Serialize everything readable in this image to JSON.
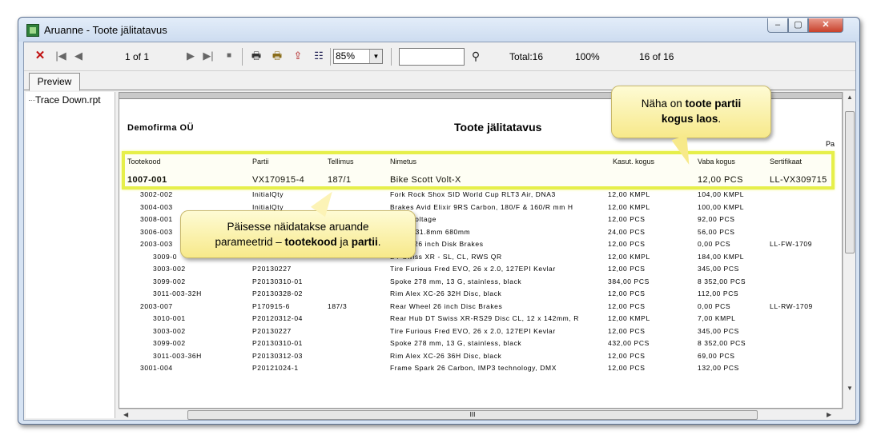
{
  "window": {
    "title": "Aruanne - Toote jälitatavus",
    "minimize": "–",
    "maximize": "▢",
    "close": "✕"
  },
  "toolbar": {
    "page_indicator": "1 of 1",
    "zoom": "85%",
    "total": "Total:16",
    "percent": "100%",
    "count": "16 of 16",
    "icons": [
      "close-icon",
      "first-page-icon",
      "prev-page-icon",
      "next-page-icon",
      "last-page-icon",
      "stop-icon",
      "print-icon",
      "print-setup-icon",
      "export-icon",
      "group-tree-icon",
      "search-binoculars-icon"
    ]
  },
  "tabs": {
    "preview": "Preview"
  },
  "tree": {
    "item": "Trace Down.rpt"
  },
  "report": {
    "company": "Demofirma OÜ",
    "title": "Toote jälitatavus",
    "pa": "Pa",
    "headers": {
      "tootekood": "Tootekood",
      "partii": "Partii",
      "tellimus": "Tellimus",
      "nimetus": "Nimetus",
      "kasut": "Kasut. kogus",
      "vaba": "Vaba kogus",
      "sert": "Sertifikaat"
    },
    "main_row": {
      "code": "1007-001",
      "batch": "VX170915-4",
      "order": "187/1",
      "name": "Bike Scott Volt-X",
      "free": "12,00 PCS",
      "cert": "LL-VX309715"
    },
    "rows": [
      {
        "code": "3002-002",
        "batch": "InitialQty",
        "order": "",
        "name": "Fork Rock Shox SID World Cup RLT3 Air, DNA3",
        "used": "12,00 KMPL",
        "free": "104,00 KMPL",
        "cert": ""
      },
      {
        "code": "3004-003",
        "batch": "InitialQty",
        "order": "",
        "name": "Brakes Avid Elixir 9RS Carbon, 180/F & 160/R mm H",
        "used": "12,00 KMPL",
        "free": "100,00 KMPL",
        "cert": ""
      },
      {
        "code": "3008-001",
        "batch": "",
        "order": "",
        "name": "Scott Voltage",
        "used": "12,00 PCS",
        "free": "92,00 PCS",
        "cert": ""
      },
      {
        "code": "3006-003",
        "batch": "",
        "order": "",
        "name": "15 Pro 31.8mm 680mm",
        "used": "24,00 PCS",
        "free": "56,00 PCS",
        "cert": ""
      },
      {
        "code": "2003-003",
        "batch": "",
        "order": "",
        "name": "Wheel 26 inch Disk Brakes",
        "used": "12,00 PCS",
        "free": "0,00 PCS",
        "cert": "LL-FW-1709"
      },
      {
        "code": "3009-0",
        "batch": "",
        "order": "",
        "name": "DT Swiss XR - SL, CL, RWS QR",
        "used": "12,00 KMPL",
        "free": "184,00 KMPL",
        "cert": ""
      },
      {
        "code": "3003-002",
        "batch": "P20130227",
        "order": "",
        "name": "Tire Furious Fred EVO, 26 x 2.0, 127EPI Kevlar",
        "used": "12,00 PCS",
        "free": "345,00 PCS",
        "cert": ""
      },
      {
        "code": "3099-002",
        "batch": "P20130310-01",
        "order": "",
        "name": "Spoke 278 mm, 13 G, stainless, black",
        "used": "384,00 PCS",
        "free": "8 352,00 PCS",
        "cert": ""
      },
      {
        "code": "3011-003-32H",
        "batch": "P20130328-02",
        "order": "",
        "name": "Rim Alex XC-26 32H Disc, black",
        "used": "12,00 PCS",
        "free": "112,00 PCS",
        "cert": ""
      },
      {
        "code": "2003-007",
        "batch": "P170915-6",
        "order": "187/3",
        "name": "Rear Wheel 26 inch Disc Brakes",
        "used": "12,00 PCS",
        "free": "0,00 PCS",
        "cert": "LL-RW-1709"
      },
      {
        "code": "3010-001",
        "batch": "P20120312-04",
        "order": "",
        "name": "Rear Hub DT Swiss XR-RS29 Disc CL, 12 x 142mm, R",
        "used": "12,00 KMPL",
        "free": "7,00 KMPL",
        "cert": ""
      },
      {
        "code": "3003-002",
        "batch": "P20130227",
        "order": "",
        "name": "Tire Furious Fred EVO, 26 x 2.0, 127EPI Kevlar",
        "used": "12,00 PCS",
        "free": "345,00 PCS",
        "cert": ""
      },
      {
        "code": "3099-002",
        "batch": "P20130310-01",
        "order": "",
        "name": "Spoke 278 mm, 13 G, stainless, black",
        "used": "432,00 PCS",
        "free": "8 352,00 PCS",
        "cert": ""
      },
      {
        "code": "3011-003-36H",
        "batch": "P20130312-03",
        "order": "",
        "name": "Rim Alex XC-26 36H Disc, black",
        "used": "12,00 PCS",
        "free": "69,00 PCS",
        "cert": ""
      },
      {
        "code": "3001-004",
        "batch": "P20121024-1",
        "order": "",
        "name": "Frame Spark 26 Carbon, IMP3 technology, DMX",
        "used": "12,00 PCS",
        "free": "132,00 PCS",
        "cert": ""
      }
    ]
  },
  "callouts": {
    "right": {
      "pre": "Näha on ",
      "bold1": "toote partii",
      "mid": "",
      "bold2": "kogus laos",
      "post": "."
    },
    "left": {
      "line1": "Päisesse näidatakse aruande",
      "pre": "parameetrid – ",
      "bold1": "tootekood",
      "mid": " ja ",
      "bold2": "partii",
      "post": "."
    }
  },
  "colors": {
    "highlight": "#e6ef4a",
    "callout": "#fbf3b0"
  }
}
